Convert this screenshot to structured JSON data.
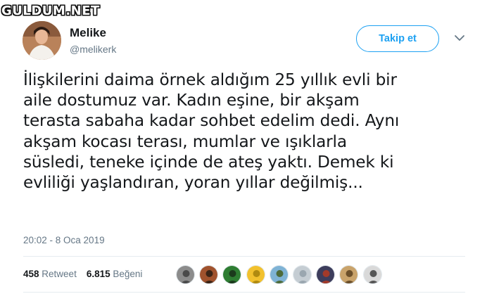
{
  "watermark": "GULDUM.NET",
  "user": {
    "name": "Melike",
    "handle": "@melikerk"
  },
  "follow_label": "Takip et",
  "tweet_text": "İlişkilerini daima örnek aldığım 25 yıllık evli bir\naile dostumuz var. Kadın eşine, bir akşam\nterasta sabaha kadar sohbet edelim dedi. Aynı\nakşam kocası terası, mumlar ve ışıklarla\nsüsledi, teneke içinde de ateş yaktı. Demek ki\nevliliği yaşlandıran, yoran yıllar değilmiş...",
  "timestamp": "20:02 - 8 Oca 2019",
  "stats": {
    "retweet_count": "458",
    "retweet_label": "Retweet",
    "like_count": "6.815",
    "like_label": "Beğeni"
  },
  "likers": [
    {
      "name": "liker-1",
      "bg": "#8c8c8c",
      "fg": "#4a4a4a"
    },
    {
      "name": "liker-2",
      "bg": "#a0522d",
      "fg": "#3b2416"
    },
    {
      "name": "liker-3",
      "bg": "#2e7d32",
      "fg": "#1b3a1c"
    },
    {
      "name": "liker-4",
      "bg": "#f2c12e",
      "fg": "#b08a10"
    },
    {
      "name": "liker-5",
      "bg": "#7fb3d5",
      "fg": "#4d6b3a"
    },
    {
      "name": "liker-6",
      "bg": "#c5cdd3",
      "fg": "#9aa6af"
    },
    {
      "name": "liker-7",
      "bg": "#3d3d5c",
      "fg": "#a33a2a"
    },
    {
      "name": "liker-8",
      "bg": "#c9a36b",
      "fg": "#6b4f2a"
    },
    {
      "name": "liker-9",
      "bg": "#d9d9d9",
      "fg": "#555555"
    }
  ],
  "colors": {
    "accent": "#1da1f2",
    "muted": "#657786",
    "text": "#14171a"
  }
}
